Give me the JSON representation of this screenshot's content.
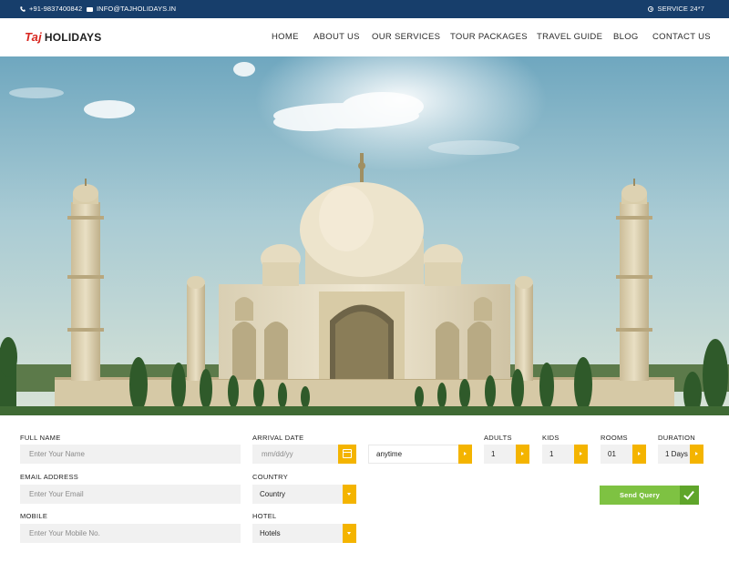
{
  "topbar": {
    "phone": "+91-9837400842",
    "email": "INFO@TAJHOLIDAYS.IN",
    "service": "SERVICE 24*7"
  },
  "brand": {
    "first": "Taj",
    "second": "HOLIDAYS"
  },
  "nav": {
    "home": "HOME",
    "about": "ABOUT US",
    "services": "OUR SERVICES",
    "tours": "TOUR PACKAGES",
    "guide": "TRAVEL GUIDE",
    "blog": "BLOG",
    "contact": "CONTACT US"
  },
  "form": {
    "full_name": {
      "label": "FULL NAME",
      "placeholder": "Enter Your Name"
    },
    "email": {
      "label": "EMAIL ADDRESS",
      "placeholder": "Enter Your Email"
    },
    "mobile": {
      "label": "MOBILE",
      "placeholder": "Enter Your Mobile No."
    },
    "arrival": {
      "label": "ARRIVAL DATE",
      "placeholder": "mm/dd/yy"
    },
    "time": {
      "value": "anytime"
    },
    "country": {
      "label": "COUNTRY",
      "value": "Country"
    },
    "hotel": {
      "label": "HOTEL",
      "value": "Hotels"
    },
    "adults": {
      "label": "ADULTS",
      "value": "1"
    },
    "kids": {
      "label": "KIDS",
      "value": "1"
    },
    "rooms": {
      "label": "ROOMS",
      "value": "01"
    },
    "duration": {
      "label": "DURATION",
      "value": "1 Days"
    },
    "submit": "Send Query"
  },
  "colors": {
    "topbar": "#173e6b",
    "accent": "#f4b400",
    "submit": "#7ec242",
    "brand_red": "#d8261f"
  }
}
